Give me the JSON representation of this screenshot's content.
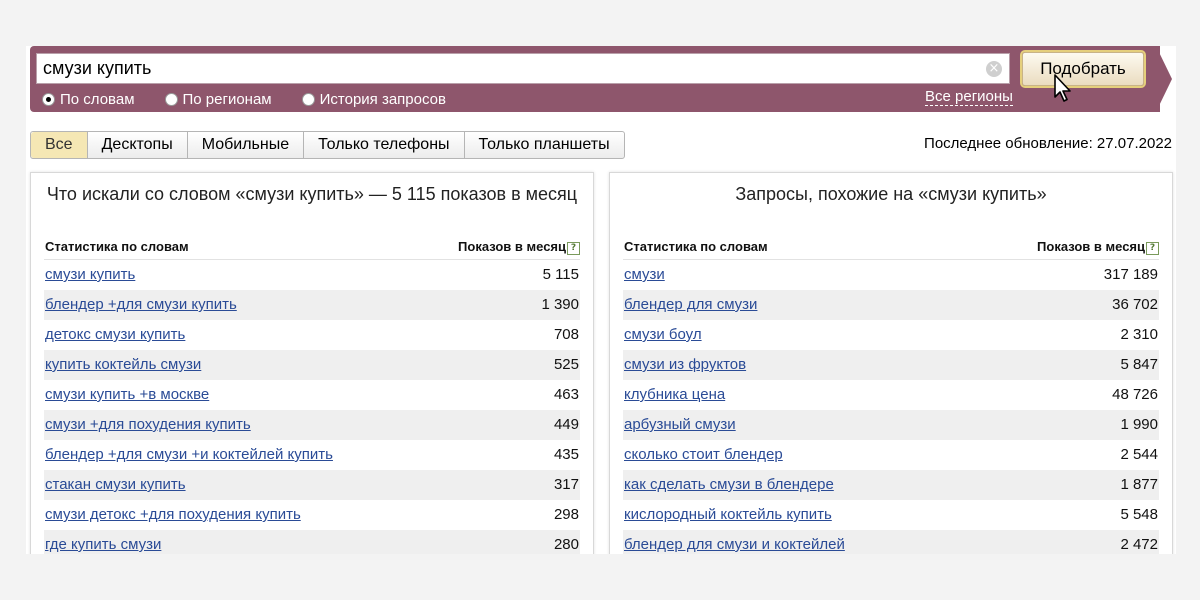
{
  "search": {
    "query": "смузи купить",
    "button_label": "Подобрать",
    "clear_glyph": "×",
    "radios": [
      {
        "label": "По словам",
        "checked": true
      },
      {
        "label": "По регионам",
        "checked": false
      },
      {
        "label": "История запросов",
        "checked": false
      }
    ],
    "regions_link": "Все регионы"
  },
  "tabs": [
    {
      "label": "Все",
      "active": true
    },
    {
      "label": "Десктопы",
      "active": false
    },
    {
      "label": "Мобильные",
      "active": false
    },
    {
      "label": "Только телефоны",
      "active": false
    },
    {
      "label": "Только планшеты",
      "active": false
    }
  ],
  "last_update": "Последнее обновление: 27.07.2022",
  "left_panel": {
    "title": "Что искали со словом «смузи купить» — 5 115 показов в месяц",
    "col_words": "Статистика по словам",
    "col_count": "Показов в месяц",
    "help_glyph": "?",
    "rows": [
      {
        "phrase": "смузи купить",
        "count": "5 115"
      },
      {
        "phrase": "блендер +для смузи купить",
        "count": "1 390"
      },
      {
        "phrase": "детокс смузи купить",
        "count": "708"
      },
      {
        "phrase": "купить коктейль смузи",
        "count": "525"
      },
      {
        "phrase": "смузи купить +в москве",
        "count": "463"
      },
      {
        "phrase": "смузи +для похудения купить",
        "count": "449"
      },
      {
        "phrase": "блендер +для смузи +и коктейлей купить",
        "count": "435"
      },
      {
        "phrase": "стакан смузи купить",
        "count": "317"
      },
      {
        "phrase": "смузи детокс +для похудения купить",
        "count": "298"
      },
      {
        "phrase": "где купить смузи",
        "count": "280"
      }
    ]
  },
  "right_panel": {
    "title": "Запросы, похожие на «смузи купить»",
    "col_words": "Статистика по словам",
    "col_count": "Показов в месяц",
    "help_glyph": "?",
    "rows": [
      {
        "phrase": "смузи",
        "count": "317 189"
      },
      {
        "phrase": "блендер для смузи",
        "count": "36 702"
      },
      {
        "phrase": "смузи боул",
        "count": "2 310"
      },
      {
        "phrase": "смузи из фруктов",
        "count": "5 847"
      },
      {
        "phrase": "клубника цена",
        "count": "48 726"
      },
      {
        "phrase": "арбузный смузи",
        "count": "1 990"
      },
      {
        "phrase": "сколько стоит блендер",
        "count": "2 544"
      },
      {
        "phrase": "как сделать смузи в блендере",
        "count": "1 877"
      },
      {
        "phrase": "кислородный коктейль купить",
        "count": "5 548"
      },
      {
        "phrase": "блендер для смузи и коктейлей",
        "count": "2 472"
      }
    ]
  },
  "colors": {
    "search_bar": "#8e566c",
    "link": "#2a4b96",
    "active_tab": "#f5e7b4"
  }
}
